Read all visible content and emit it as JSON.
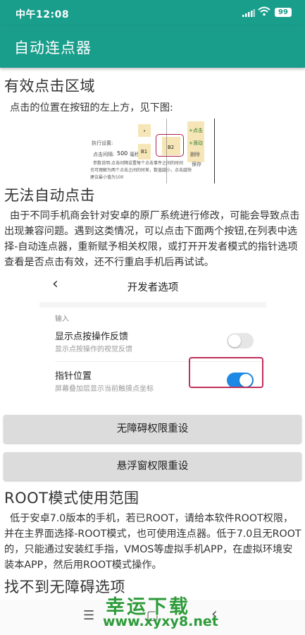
{
  "status_bar": {
    "time": "中午12:08",
    "battery": "99",
    "icons": [
      "signal-icon",
      "wifi-icon",
      "battery-icon"
    ]
  },
  "app_bar": {
    "title": "自动连点器"
  },
  "sections": {
    "effective_area": {
      "heading": "有效点击区域",
      "text": "点击的位置在按钮的左上方，见下图:"
    },
    "figure1": {
      "setting_label": "执行设置:",
      "interval_label": "点击间隔:",
      "interval_value": "500",
      "interval_unit": "毫秒",
      "b1": "B1",
      "b2": "B2",
      "b3": "•",
      "side1": "+点击",
      "side2": "+滑动",
      "side3": "删除",
      "side4": "保存",
      "note1": "参数说明:点击间隔设置每个点击事件之间的时间",
      "note2": "也可理解为两个点击之间的时差，数值越小，点击越快",
      "note3": "建议最小值为100"
    },
    "auto_fail": {
      "heading": "无法自动点击",
      "text": "由于不同手机商会针对安卓的原厂系统进行修改，可能会导致点击出现兼容问题。遇到这类情况，可以点击下面两个按钮,在列表中选择-自动连点器，重新赋予相关权限，或打开开发者模式的指针选项查看是否点击有效，还不行重启手机后再试试。"
    },
    "dev_options": {
      "back": "‹",
      "title": "开发者选项",
      "section_label": "输入",
      "item1_title": "显示点按操作反馈",
      "item1_sub": "显示点按操作的视觉反馈",
      "item1_on": false,
      "item2_title": "指针位置",
      "item2_sub": "屏幕叠加层显示当前触摸点坐标",
      "item2_on": true,
      "accent": "#1e88e5"
    },
    "buttons": {
      "accessibility_reset": "无障碍权限重设",
      "overlay_reset": "悬浮窗权限重设"
    },
    "root_mode": {
      "heading": "ROOT模式使用范围",
      "text": "低于安卓7.0版本的手机，若已ROOT，请给本软件ROOT权限，并在主界面选择-ROOT模式，也可使用连点器。低于7.0且无ROOT的，只能通过安装红手指，VMOS等虚拟手机APP，在虚拟环境安装本APP，然后用ROOT模式操作。"
    },
    "no_accessibility": {
      "heading": "找不到无障碍选项"
    }
  },
  "nav_bar": {
    "menu": "☰",
    "home": "▢",
    "back": "‹"
  },
  "watermark": {
    "line1": "幸运下载",
    "line2": "www.xyxy8.net"
  },
  "colors": {
    "primary": "#1a9e8c",
    "button_bg": "#dcdcdc",
    "highlight": "#c0305a"
  }
}
